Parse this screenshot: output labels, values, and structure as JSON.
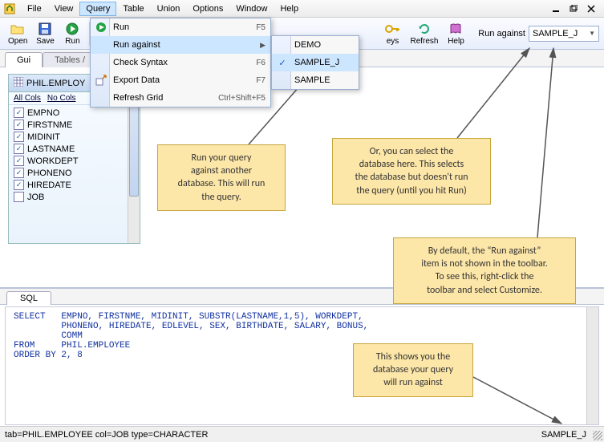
{
  "menubar": {
    "items": [
      "File",
      "View",
      "Query",
      "Table",
      "Union",
      "Options",
      "Window",
      "Help"
    ]
  },
  "toolbar": {
    "open": "Open",
    "save": "Save",
    "run": "Run",
    "keys": "eys",
    "refresh": "Refresh",
    "help": "Help",
    "run_against_label": "Run against",
    "run_against_value": "SAMPLE_J"
  },
  "query_menu": {
    "run": {
      "label": "Run",
      "shortcut": "F5"
    },
    "run_against": {
      "label": "Run against"
    },
    "check_syntax": {
      "label": "Check Syntax",
      "shortcut": "F6"
    },
    "export_data": {
      "label": "Export Data",
      "shortcut": "F7"
    },
    "refresh_grid": {
      "label": "Refresh Grid",
      "shortcut": "Ctrl+Shift+F5"
    }
  },
  "submenu": {
    "items": [
      "DEMO",
      "SAMPLE_J",
      "SAMPLE"
    ],
    "checked_index": 1
  },
  "tabs": {
    "gui": "Gui",
    "tables": "Tables /"
  },
  "columns_panel": {
    "title": "PHIL.EMPLOY",
    "allcols": "All Cols",
    "nocols": "No Cols",
    "items": [
      {
        "name": "EMPNO",
        "checked": true
      },
      {
        "name": "FIRSTNME",
        "checked": true
      },
      {
        "name": "MIDINIT",
        "checked": true
      },
      {
        "name": "LASTNAME",
        "checked": true
      },
      {
        "name": "WORKDEPT",
        "checked": true
      },
      {
        "name": "PHONENO",
        "checked": true
      },
      {
        "name": "HIREDATE",
        "checked": true
      },
      {
        "name": "JOB",
        "checked": false
      }
    ]
  },
  "sql": {
    "tab": "SQL",
    "text": "SELECT   EMPNO, FIRSTNME, MIDINIT, SUBSTR(LASTNAME,1,5), WORKDEPT,\n         PHONENO, HIREDATE, EDLEVEL, SEX, BIRTHDATE, SALARY, BONUS,\n         COMM\nFROM     PHIL.EMPLOYEE\nORDER BY 2, 8"
  },
  "status": {
    "left": "tab=PHIL.EMPLOYEE col=JOB type=CHARACTER",
    "right": "SAMPLE_J"
  },
  "callouts": {
    "c1": "Run your query\nagainst another\ndatabase. This will run\nthe query.",
    "c2": "Or, you can select the\ndatabase here. This selects\nthe database but doesn't run\nthe query (until you hit Run)",
    "c3": "By default, the “Run against”\nitem is not shown in the toolbar.\nTo see this, right-click the\ntoolbar and select Customize.",
    "c4": "This shows you the\ndatabase your query\nwill run against"
  }
}
